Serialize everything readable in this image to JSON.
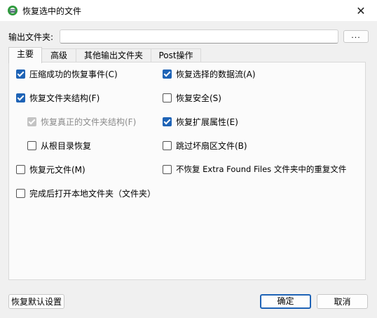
{
  "window": {
    "title": "恢复选中的文件",
    "close_glyph": "✕"
  },
  "output": {
    "label": "输出文件夹:",
    "value": "",
    "browse_label": "..."
  },
  "tabs": [
    {
      "label": "主要",
      "active": true
    },
    {
      "label": "高级",
      "active": false
    },
    {
      "label": "其他输出文件夹",
      "active": false
    },
    {
      "label": "Post操作",
      "active": false
    }
  ],
  "options": {
    "compress_events": {
      "label": "压缩成功的恢复事件(C)",
      "checked": true
    },
    "folder_structure": {
      "label": "恢复文件夹结构(F)",
      "checked": true
    },
    "true_folder_structure": {
      "label": "恢复真正的文件夹结构(F)",
      "checked": true,
      "disabled": true
    },
    "from_root": {
      "label": "从根目录恢复",
      "checked": false
    },
    "meta_files": {
      "label": "恢复元文件(M)",
      "checked": false
    },
    "open_local_folder": {
      "label": "完成后打开本地文件夹（文件夹）",
      "checked": false
    },
    "selected_streams": {
      "label": "恢复选择的数据流(A)",
      "checked": true
    },
    "security": {
      "label": "恢复安全(S)",
      "checked": false
    },
    "extended_attrs": {
      "label": "恢复扩展属性(E)",
      "checked": true
    },
    "skip_bad_sectors": {
      "label": "跳过坏扇区文件(B)",
      "checked": false
    },
    "no_extra_found_dupes": {
      "label": "不恢复 Extra Found Files 文件夹中的重复文件",
      "checked": false
    }
  },
  "buttons": {
    "restore_defaults": "恢复默认设置",
    "ok": "确定",
    "cancel": "取消"
  },
  "colors": {
    "accent": "#1e63b6",
    "app_icon_green": "#2e9a3c"
  }
}
